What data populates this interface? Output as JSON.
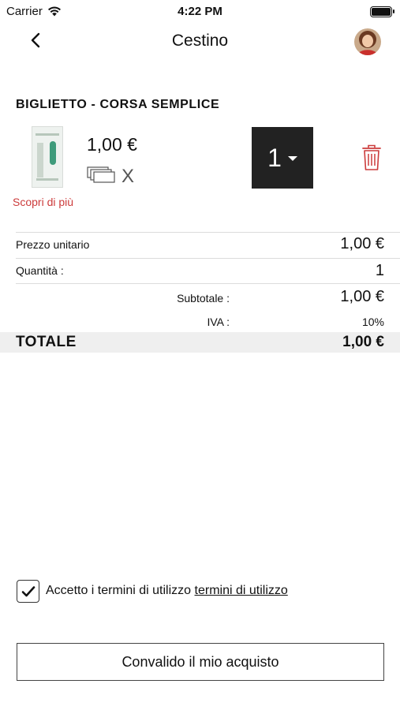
{
  "status_bar": {
    "carrier": "Carrier",
    "time": "4:22 PM"
  },
  "nav": {
    "title": "Cestino",
    "back_icon": "chevron-left-icon"
  },
  "product": {
    "title": "BIGLIETTO - CORSA SEMPLICE",
    "price": "1,00 €",
    "x_label": "X",
    "learn_more": "Scopri di più",
    "quantity": "1"
  },
  "summary": {
    "unit_price_label": "Prezzo unitario",
    "unit_price_value": "1,00 €",
    "quantity_label": "Quantità :",
    "quantity_value": "1",
    "subtotal_label": "Subtotale :",
    "subtotal_value": "1,00 €",
    "vat_label": "IVA :",
    "vat_value": "10%",
    "total_label": "TOTALE",
    "total_value": "1,00 €"
  },
  "terms": {
    "checked": true,
    "text": "Accetto i termini di utilizzo",
    "link": "termini di utilizzo"
  },
  "confirm_button": "Convalido il mio acquisto",
  "colors": {
    "accent_red": "#cc3b3b",
    "qty_box": "#222222",
    "total_bg": "#efefef"
  }
}
